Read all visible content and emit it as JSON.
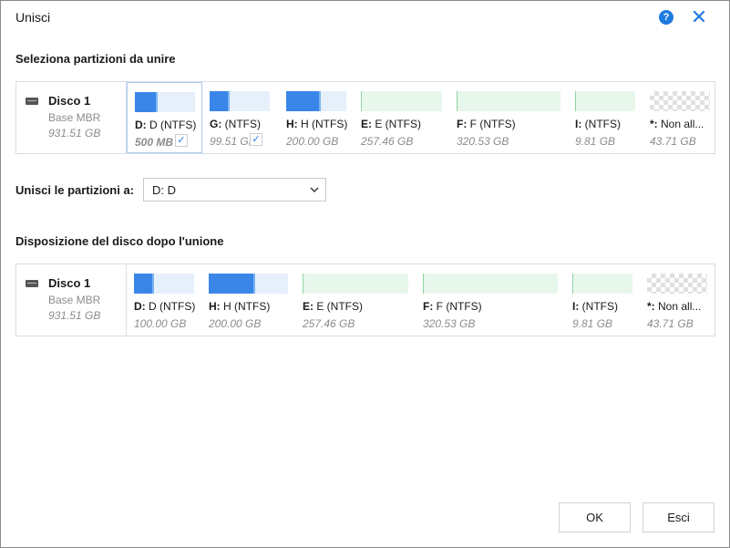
{
  "window": {
    "title": "Unisci"
  },
  "header": {
    "help_glyph": "?"
  },
  "section_select": {
    "heading": "Seleziona partizioni da unire"
  },
  "section_result": {
    "heading": "Disposizione del disco dopo l'unione"
  },
  "disk": {
    "name": "Disco 1",
    "type": "Base MBR",
    "size": "931.51 GB"
  },
  "select_partitions": [
    {
      "letter": "D:",
      "name": "D (NTFS)",
      "size": "500 MB",
      "kind": "system",
      "fill_pct": 38,
      "checked": true,
      "selected": true
    },
    {
      "letter": "G:",
      "name": " (NTFS)",
      "size": "99.51 GB",
      "kind": "system",
      "fill_pct": 33,
      "checked": true,
      "selected": false
    },
    {
      "letter": "H:",
      "name": "H (NTFS)",
      "size": "200.00 GB",
      "kind": "system",
      "fill_pct": 58,
      "checked": false,
      "selected": false
    },
    {
      "letter": "E:",
      "name": "E (NTFS)",
      "size": "257.46 GB",
      "kind": "data",
      "fill_pct": 1,
      "checked": false,
      "selected": false
    },
    {
      "letter": "F:",
      "name": "F (NTFS)",
      "size": "320.53 GB",
      "kind": "data",
      "fill_pct": 1,
      "checked": false,
      "selected": false
    },
    {
      "letter": "I:",
      "name": " (NTFS)",
      "size": "9.81 GB",
      "kind": "data",
      "fill_pct": 2,
      "checked": false,
      "selected": false
    },
    {
      "letter": "*:",
      "name": "Non all...",
      "size": "43.71 GB",
      "kind": "unallocated",
      "fill_pct": 0,
      "checked": false,
      "selected": false
    }
  ],
  "merge_target": {
    "label": "Unisci le partizioni a:",
    "value": "D: D"
  },
  "result_partitions": [
    {
      "letter": "D:",
      "name": "D (NTFS)",
      "size": "100.00 GB",
      "kind": "system",
      "fill_pct": 33
    },
    {
      "letter": "H:",
      "name": "H (NTFS)",
      "size": "200.00 GB",
      "kind": "system",
      "fill_pct": 59
    },
    {
      "letter": "E:",
      "name": "E (NTFS)",
      "size": "257.46 GB",
      "kind": "data",
      "fill_pct": 1
    },
    {
      "letter": "F:",
      "name": "F (NTFS)",
      "size": "320.53 GB",
      "kind": "data",
      "fill_pct": 1
    },
    {
      "letter": "I:",
      "name": " (NTFS)",
      "size": "9.81 GB",
      "kind": "data",
      "fill_pct": 2
    },
    {
      "letter": "*:",
      "name": "Non all...",
      "size": "43.71 GB",
      "kind": "unallocated",
      "fill_pct": 0
    }
  ],
  "footer": {
    "ok_label": "OK",
    "cancel_label": "Esci"
  },
  "icons": {
    "help": "help-icon",
    "close": "close-icon",
    "disk": "disk-icon",
    "dropdown": "chevron-down-icon",
    "check": "checkmark-icon"
  },
  "colors": {
    "accent": "#1f7ae0",
    "used_system": "#3a86e8",
    "used_data": "#b5e3c2"
  }
}
